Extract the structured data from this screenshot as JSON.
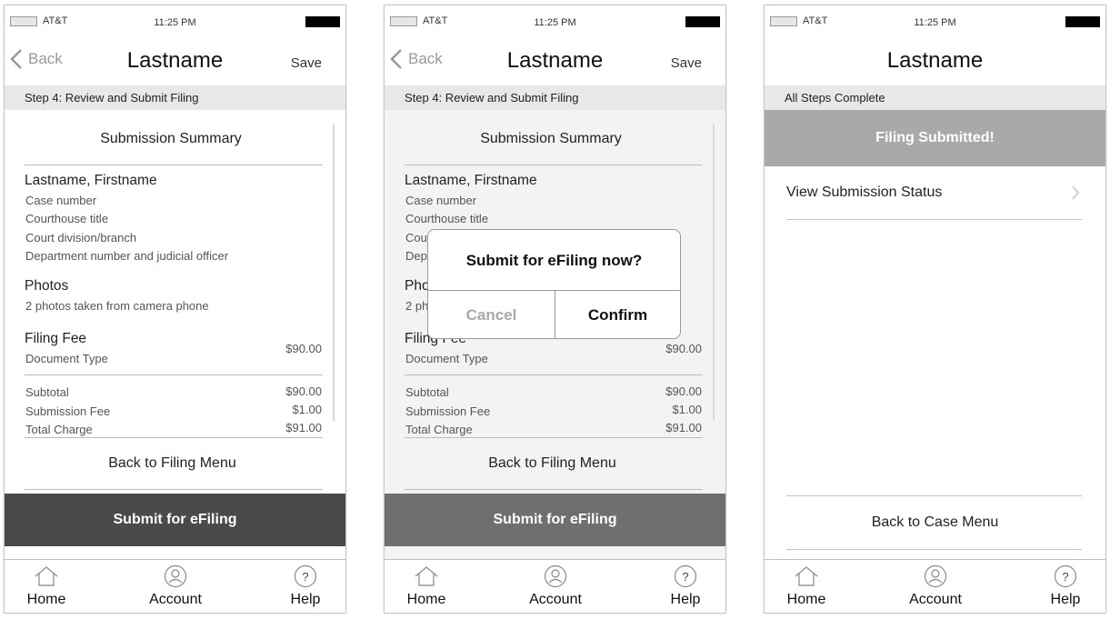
{
  "common": {
    "carrier": "AT&T",
    "time": "11:25 PM",
    "title": "Lastname",
    "back_label": "Back",
    "save_label": "Save",
    "step_label": "Step 4:  Review and Submit Filing",
    "summary_title": "Submission Summary",
    "person_name": "Lastname, Firstname",
    "case_number": "Case number",
    "courthouse_title": "Courthouse title",
    "court_division": "Court division/branch",
    "department": "Department number and judicial officer",
    "photos_heading": "Photos",
    "photos_detail": "2 photos taken from camera phone",
    "fee_heading": "Filing Fee",
    "document_type": "Document Type",
    "fee_amount": "$90.00",
    "subtotal_label": "Subtotal",
    "subtotal_value": "$90.00",
    "submission_fee_label": "Submission Fee",
    "submission_fee_value": "$1.00",
    "total_label": "Total Charge",
    "total_value": "$91.00",
    "back_to_filing": "Back to Filing Menu",
    "submit_label": "Submit for eFiling"
  },
  "screen2": {
    "dialog_title": "Submit for eFiling now?",
    "cancel": "Cancel",
    "confirm": "Confirm",
    "clipped_lines": {
      "court_division": "Cou",
      "department": "Dep",
      "photos_heading": "Pho",
      "photos_detail": "2 ph",
      "fee_heading": "Filing Fee"
    }
  },
  "screen3": {
    "step_label": "All Steps Complete",
    "banner": "Filing Submitted!",
    "view_status": "View Submission Status",
    "back_to_case": "Back to Case Menu"
  },
  "tabbar": {
    "home": "Home",
    "account": "Account",
    "help": "Help",
    "help_glyph": "?"
  },
  "colors": {
    "submit_button": "#4a4a4a",
    "submit_button_dimmed": "#6f6f6f",
    "banner": "#a9a9a9",
    "step_bar": "#e8e8e8"
  }
}
